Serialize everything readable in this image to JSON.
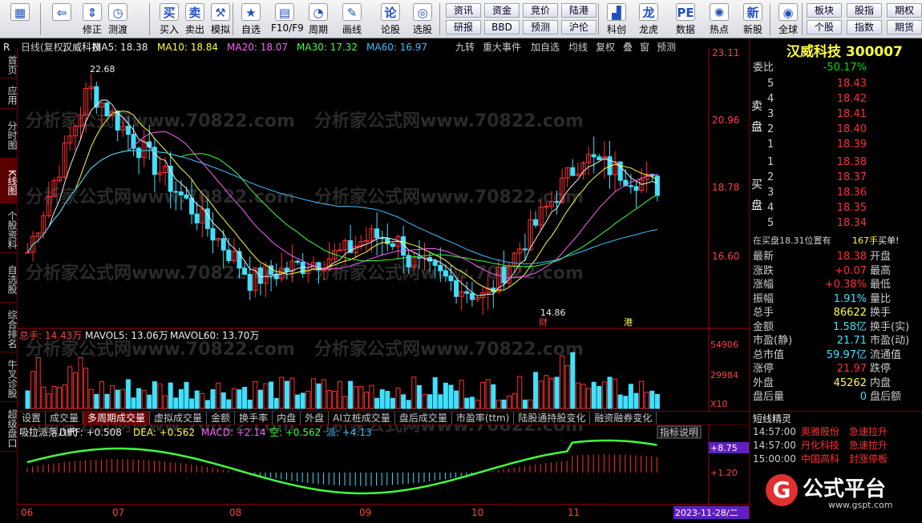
{
  "toolbar": {
    "buttons": [
      {
        "label": "",
        "icon": "color-blocks-icon"
      },
      {
        "label": "",
        "icon": "back-arrow-icon"
      },
      {
        "label": "修正",
        "icon": "up-down-icon"
      },
      {
        "label": "测渡",
        "icon": "clock-icon"
      },
      {
        "label": "买入",
        "icon": "buy-icon"
      },
      {
        "label": "卖出",
        "icon": "sell-icon"
      },
      {
        "label": "模拟",
        "icon": "hammer-icon"
      },
      {
        "label": "自选",
        "icon": "star-icon"
      },
      {
        "label": "F10/F9",
        "icon": "document-icon"
      },
      {
        "label": "周期",
        "icon": "cycle-icon"
      },
      {
        "label": "画线",
        "icon": "pencil-icon"
      },
      {
        "label": "论股",
        "icon": "discuss-icon"
      },
      {
        "label": "选股",
        "icon": "select-icon"
      },
      {
        "label": "科创",
        "icon": "chart-icon"
      },
      {
        "label": "龙虎",
        "icon": "dragon-icon"
      },
      {
        "label": "数据",
        "icon": "pe-icon"
      },
      {
        "label": "热点",
        "icon": "hot-icon"
      },
      {
        "label": "新股",
        "icon": "new-icon"
      },
      {
        "label": "全球",
        "icon": "globe-icon"
      }
    ],
    "small": [
      "资讯",
      "资金",
      "竞价",
      "陆港",
      "研报",
      "BBD",
      "预测",
      "沪伦",
      "板块",
      "股指",
      "期权",
      "个股",
      "指数",
      "期货"
    ]
  },
  "left_tabs": [
    "首页",
    "应用",
    "分时图",
    "K线图",
    "个股资料",
    "自选股",
    "综合排名",
    "牛叉诊股",
    "超级盘口"
  ],
  "chart": {
    "header": "日线(复权)",
    "name": "汉威科技",
    "ma5": "MA5: 18.38",
    "ma10": "MA10: 18.84",
    "ma20": "MA20: 18.07",
    "ma30": "MA30: 17.32",
    "ma60": "MA60: 16.97",
    "tools": [
      "九转",
      "重大事件",
      "加自选",
      "均线",
      "复权",
      "叠",
      "窗",
      "预测"
    ],
    "price_ticks": [
      "23.11",
      "20.96",
      "18.78",
      "16.60"
    ],
    "high_label": "22.68",
    "low_label": "14.86",
    "marks": [
      "财",
      "港"
    ],
    "vol_header": "总手: 14.43万",
    "mavol5": "MAVOL5: 13.06万",
    "mavol60": "MAVOL60: 13.70万",
    "vol_ticks": [
      "54906",
      "29984",
      "X10"
    ],
    "tabs": [
      "设置",
      "成交量",
      "多周期成交量",
      "虚拟成交量",
      "金额",
      "换手率",
      "内盘",
      "外盘",
      "AI立桩成交量",
      "盘后成交量",
      "市盈率(ttm)",
      "陆股通持股变化",
      "融资融券变化"
    ],
    "macd_header": "吸拉派落八代",
    "diff": "DIFF: +0.508",
    "dea": "DEA: +0.562",
    "macd": "MACD: +2.14",
    "kong": "空: +0.562",
    "pai": "派: +4.13",
    "explain": "指标说明",
    "macd_ticks": [
      "+8.75",
      "+1.20"
    ],
    "months": [
      "06",
      "07",
      "08",
      "09",
      "10",
      "11"
    ],
    "date": "2023-11-28/二",
    "watermark": "分析家公式网www.70822.com"
  },
  "right": {
    "title": "汉威科技 300007",
    "r": "R",
    "weibi_k": "委比",
    "weibi_v": "-50.17%",
    "sell": [
      [
        "5",
        "18.43"
      ],
      [
        "4",
        "18.42"
      ],
      [
        "3",
        "18.41"
      ],
      [
        "2",
        "18.40"
      ],
      [
        "1",
        "18.39"
      ]
    ],
    "sell_label": "卖盘",
    "buy": [
      [
        "1",
        "18.38"
      ],
      [
        "2",
        "18.37"
      ],
      [
        "3",
        "18.36"
      ],
      [
        "4",
        "18.35"
      ],
      [
        "5",
        "18.34"
      ]
    ],
    "buy_label": "买盘",
    "info": "在买盘18.31位置有",
    "info_v": "167手",
    "info_r": "买单!",
    "stats": [
      [
        "最新",
        "18.38",
        "开盘"
      ],
      [
        "涨跌",
        "+0.07",
        "最高"
      ],
      [
        "涨幅",
        "+0.38%",
        "最低"
      ],
      [
        "振幅",
        "1.91%",
        "量比"
      ],
      [
        "总手",
        "86622",
        "换手"
      ],
      [
        "金额",
        "1.58亿",
        "换手(实)"
      ],
      [
        "市盈(静)",
        "21.71",
        "市盈(动)"
      ],
      [
        "总市值",
        "59.97亿",
        "流通值"
      ],
      [
        "涨停",
        "21.97",
        "跌停"
      ],
      [
        "外盘",
        "45262",
        "内盘"
      ],
      [
        "盘后量",
        "0",
        "盘后额"
      ]
    ],
    "news_title": "短线精灵",
    "news": [
      [
        "14:57:00",
        "奥雅股份",
        "急速拉升"
      ],
      [
        "14:57:00",
        "丹化科技",
        "急速拉升"
      ],
      [
        "15:00:00",
        "中国高科",
        "封涨停板"
      ]
    ],
    "brand": "公式平台",
    "url": "www.gspt.com"
  }
}
